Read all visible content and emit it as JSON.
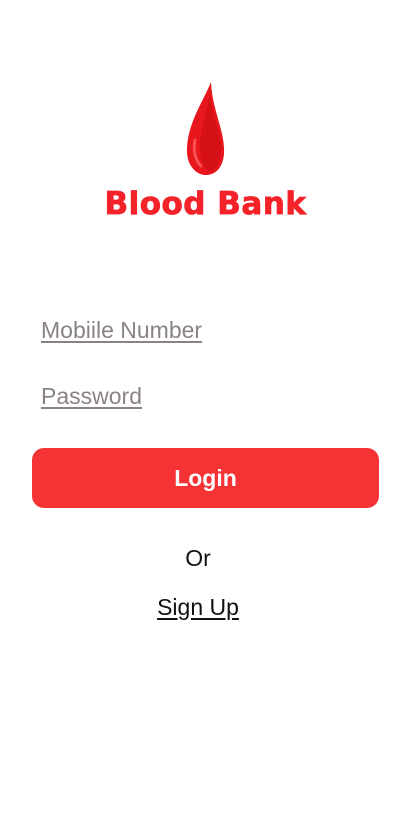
{
  "brand": {
    "logo_icon": "blood-drop-icon",
    "title": "Blood Bank",
    "color": "#f4232a"
  },
  "form": {
    "mobile_placeholder": "Mobiile Number",
    "password_placeholder": "Password",
    "login_label": "Login",
    "login_color": "#f53335"
  },
  "alt": {
    "or_text": "Or",
    "signup_label": "Sign Up"
  }
}
